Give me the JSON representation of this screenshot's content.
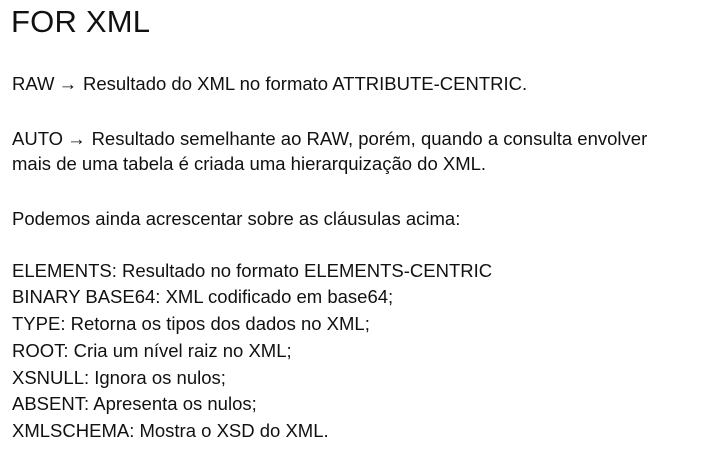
{
  "title": "FOR XML",
  "arrow_glyph": "→",
  "raw": {
    "keyword": "RAW",
    "text": "Resultado do XML no formato ATTRIBUTE-CENTRIC."
  },
  "auto": {
    "keyword": "AUTO",
    "text_line1": "Resultado semelhante ao RAW, porém, quando a consulta envolver",
    "text_line2": "mais de uma tabela é criada uma hierarquização do XML."
  },
  "intro": "Podemos ainda acrescentar sobre as cláusulas acima:",
  "clauses": [
    "ELEMENTS: Resultado no formato ELEMENTS-CENTRIC",
    "BINARY BASE64: XML codificado em base64;",
    "TYPE: Retorna os tipos dos dados no XML;",
    "ROOT: Cria um nível raiz no XML;",
    "XSNULL: Ignora os nulos;",
    "ABSENT: Apresenta os nulos;",
    "XMLSCHEMA: Mostra o XSD do XML."
  ]
}
